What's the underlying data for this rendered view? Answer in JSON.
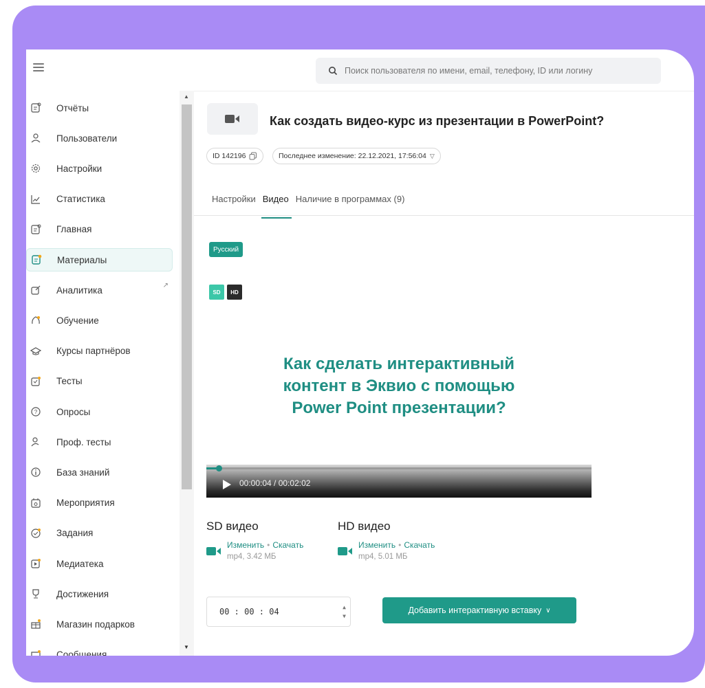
{
  "search": {
    "placeholder": "Поиск пользователя по имени, email, телефону, ID или логину"
  },
  "sidebar": {
    "items": [
      {
        "label": "Отчёты",
        "icon": "report-icon"
      },
      {
        "label": "Пользователи",
        "icon": "users-icon"
      },
      {
        "label": "Настройки",
        "icon": "gear-icon"
      },
      {
        "label": "Статистика",
        "icon": "chart-line-icon"
      },
      {
        "label": "Главная",
        "icon": "home-doc-icon"
      },
      {
        "label": "Материалы",
        "icon": "materials-icon",
        "active": true
      },
      {
        "label": "Аналитика",
        "icon": "analytics-icon",
        "external": "↗"
      },
      {
        "label": "Обучение",
        "icon": "learning-icon"
      },
      {
        "label": "Курсы партнёров",
        "icon": "graduation-cap-icon"
      },
      {
        "label": "Тесты",
        "icon": "tests-icon"
      },
      {
        "label": "Опросы",
        "icon": "polls-icon"
      },
      {
        "label": "Проф. тесты",
        "icon": "prof-tests-icon"
      },
      {
        "label": "База знаний",
        "icon": "info-icon"
      },
      {
        "label": "Мероприятия",
        "icon": "calendar-icon"
      },
      {
        "label": "Задания",
        "icon": "tasks-icon"
      },
      {
        "label": "Медиатека",
        "icon": "media-icon"
      },
      {
        "label": "Достижения",
        "icon": "trophy-icon"
      },
      {
        "label": "Магазин подарков",
        "icon": "gift-icon"
      },
      {
        "label": "Сообщения",
        "icon": "messages-icon"
      }
    ]
  },
  "material": {
    "title": "Как создать видео-курс из презентации в PowerPoint?",
    "id_chip": "ID 142196",
    "modified_chip": "Последнее изменение: 22.12.2021, 17:56:04"
  },
  "tabs": [
    {
      "label": "Настройки",
      "active": false
    },
    {
      "label": "Видео",
      "active": true
    },
    {
      "label": "Наличие в программах (9)",
      "active": false
    }
  ],
  "language_badge": "Русский",
  "video": {
    "quality_badges": [
      "SD",
      "HD"
    ],
    "overlay_text": "Как сделать интерактивный\nконтент в Эквио с помощью\nPower Point презентации?",
    "time": "00:00:04 / 00:02:02",
    "progress_fraction": 0.033
  },
  "downloads": {
    "sd": {
      "title": "SD видео",
      "change": "Изменить",
      "separator": "•",
      "download": "Скачать",
      "meta": "mp4, 3.42 МБ"
    },
    "hd": {
      "title": "HD видео",
      "change": "Изменить",
      "separator": "•",
      "download": "Скачать",
      "meta": "mp4, 5.01 МБ"
    }
  },
  "timecode": "00 : 00 : 04",
  "add_interactive_button": "Добавить интерактивную вставку",
  "colors": {
    "accent": "#1f9a89",
    "frame": "#a98bf5",
    "sd_badge": "#3cc7a8"
  }
}
